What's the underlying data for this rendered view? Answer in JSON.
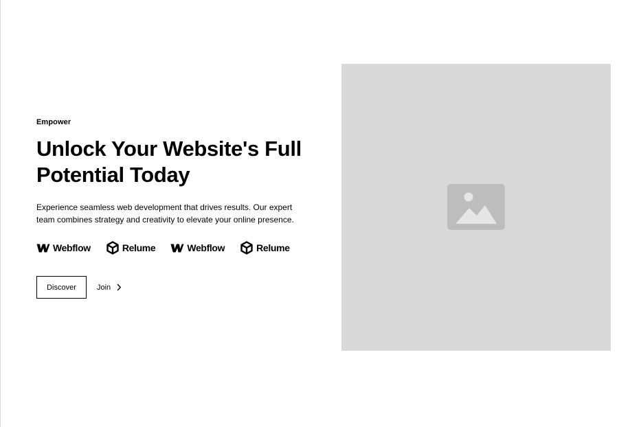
{
  "hero": {
    "tagline": "Empower",
    "headline_line1": "Unlock Your Website's Full",
    "headline_line2": "Potential Today",
    "description": "Experience seamless web development that drives results. Our expert team combines strategy and creativity to elevate your online presence."
  },
  "logos": [
    {
      "name": "Webflow",
      "icon": "webflow-logo-icon"
    },
    {
      "name": "Relume",
      "icon": "relume-cube-icon"
    },
    {
      "name": "Webflow",
      "icon": "webflow-logo-icon"
    },
    {
      "name": "Relume",
      "icon": "relume-cube-icon"
    }
  ],
  "actions": {
    "primary_label": "Discover",
    "link_label": "Join",
    "link_icon": "chevron-right-icon"
  },
  "media": {
    "icon": "image-placeholder-icon",
    "background": "#d9d9d9",
    "icon_color": "#bdbdbd"
  }
}
